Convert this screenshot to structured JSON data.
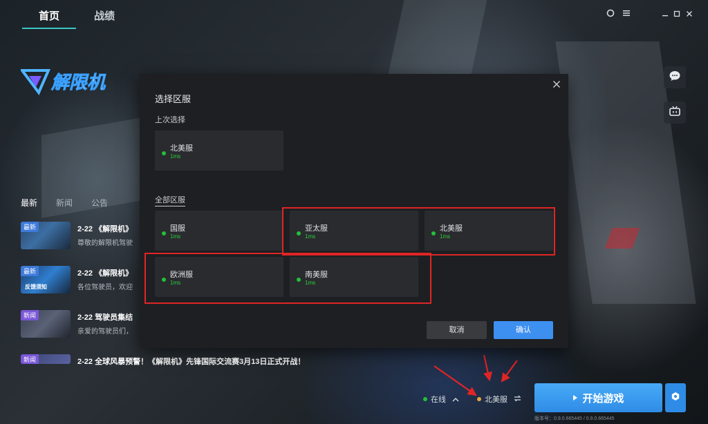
{
  "nav": {
    "home": "首页",
    "stats": "战绩"
  },
  "top_icons": [
    "circle-icon",
    "menu-icon",
    "minimize-icon",
    "maximize-icon",
    "close-icon"
  ],
  "logo_text": "解限机",
  "news": {
    "tabs": [
      "最新",
      "新闻",
      "公告"
    ],
    "items": [
      {
        "tag": "最新",
        "title": "2-22 《解限机》",
        "desc": "尊敬的解限机驾驶",
        "caption": ""
      },
      {
        "tag": "最新",
        "title": "2-22 《解限机》",
        "desc": "各位驾驶员，欢迎",
        "caption": "反馈须知"
      },
      {
        "tag": "新闻",
        "title": "2-22 驾驶员集结",
        "desc": "亲爱的驾驶员们，",
        "caption": ""
      },
      {
        "tag": "新闻",
        "title": "2-22 全球风暴预警！《解限机》先锋国际交流赛3月13日正式开战！",
        "desc": "",
        "caption": ""
      }
    ]
  },
  "side_buttons": [
    "chat-icon",
    "bilibili-icon"
  ],
  "dialog": {
    "title": "选择区服",
    "recent_heading": "上次选择",
    "recent": [
      {
        "name": "北美服",
        "ping": "1ms"
      }
    ],
    "all_heading": "全部区服",
    "servers": [
      {
        "name": "国服",
        "ping": "1ms"
      },
      {
        "name": "亚太服",
        "ping": "1ms"
      },
      {
        "name": "北美服",
        "ping": "1ms"
      },
      {
        "name": "欧洲服",
        "ping": "1ms"
      },
      {
        "name": "南美服",
        "ping": "1ms"
      }
    ],
    "cancel": "取消",
    "confirm": "确认"
  },
  "bottom": {
    "status": "在线",
    "server": "北美服",
    "start": "开始游戏",
    "version": "版本号：0.9.0.665445 / 0.9.0.665445"
  },
  "colors": {
    "accent": "#3d8ff0",
    "online": "#22c03a",
    "server_dot": "#e8a33d",
    "highlight": "#e02525"
  }
}
